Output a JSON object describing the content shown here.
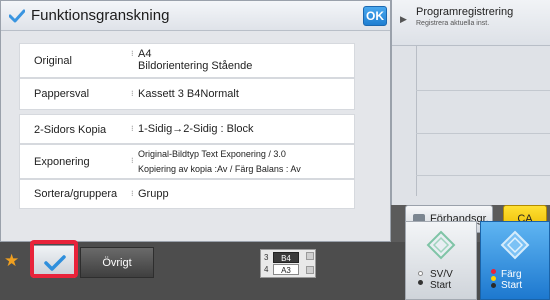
{
  "panel": {
    "title": "Funktionsgranskning",
    "ok_label": "OK",
    "rows": [
      {
        "label": "Original",
        "lines": [
          "A4",
          "Bildorientering Stående"
        ]
      },
      {
        "label": "Pappersval",
        "lines": [
          "Kassett 3 B4Normalt"
        ]
      },
      {
        "label": "2-Sidors Kopia",
        "lines": [
          "1-Sidig→2-Sidig : Block"
        ]
      },
      {
        "label": "Exponering",
        "lines": [
          "Original-Bildtyp Text Exponering / 3.0",
          "Kopiering av kopia :Av / Färg Balans : Av"
        ]
      },
      {
        "label": "Sortera/gruppera",
        "lines": [
          "Grupp"
        ]
      }
    ]
  },
  "right_panel": {
    "program_title": "Programregistrering",
    "program_subtitle": "Registrera aktuella inst.",
    "preview_label": "Förhandsgr.",
    "ca_label": "CA"
  },
  "bottom": {
    "ovrigt_label": "Övrigt",
    "tray": [
      {
        "num": "3",
        "size": "B4",
        "selected": true
      },
      {
        "num": "4",
        "size": "A3",
        "selected": false
      }
    ],
    "bw_start": {
      "line1": "SV/V",
      "line2": "Start"
    },
    "color_start": {
      "line1": "Färg",
      "line2": "Start"
    }
  },
  "colors": {
    "ok_blue": "#1f7fd2",
    "ca_yellow": "#f5c800",
    "highlight_red": "#e8233a",
    "check_blue": "#2f8fdc",
    "color_start_blue": "#2d89d8"
  }
}
